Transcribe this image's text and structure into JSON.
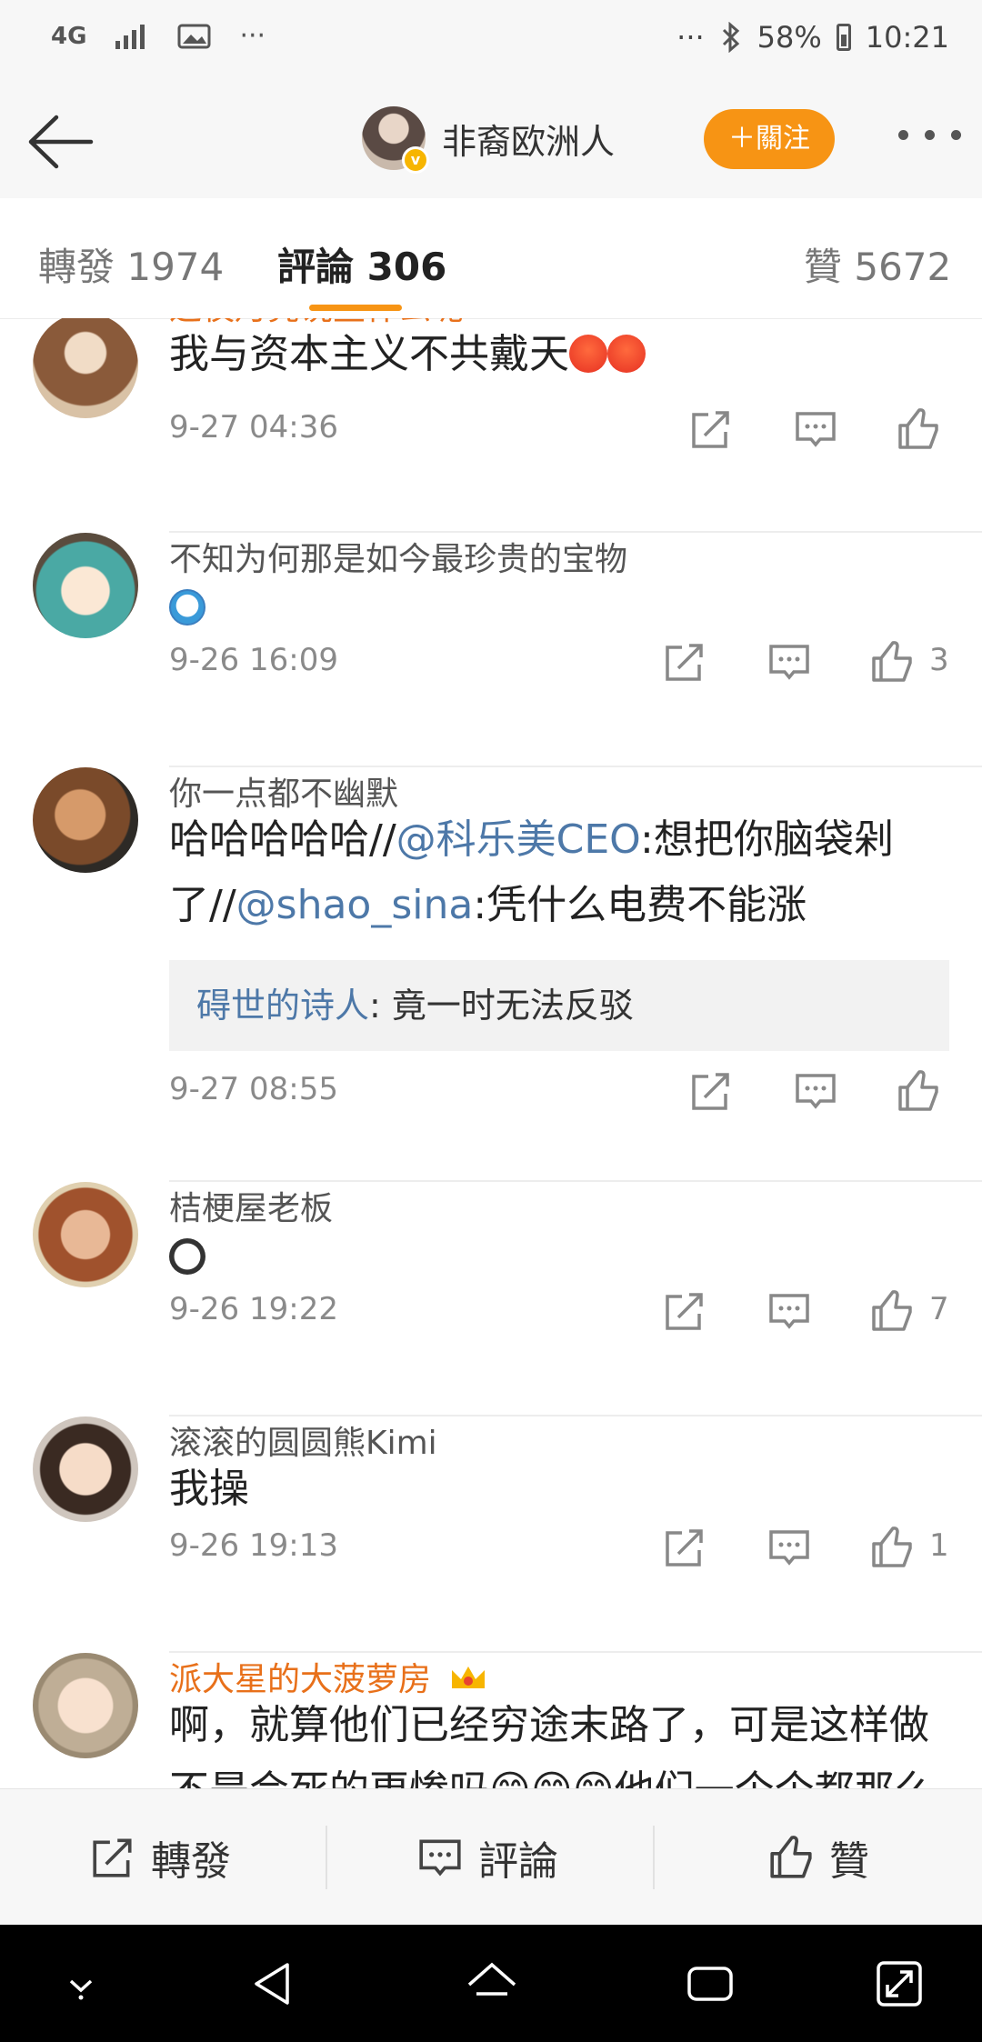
{
  "status_bar": {
    "network": "4G",
    "more": "···",
    "right_more": "···",
    "battery": "58%",
    "time": "10:21"
  },
  "nav": {
    "title": "非裔欧洲人",
    "follow_label": "＋關注"
  },
  "tabs": {
    "repost": "轉發 1974",
    "comments": "評論 306",
    "likes": "贊 5672"
  },
  "comments": [
    {
      "user": "这夜月亮说些什么呢",
      "text": "我与资本主义不共戴天",
      "time": "9-27 04:36",
      "likes": ""
    },
    {
      "user": "不知为何那是如今最珍贵的宝物",
      "time": "9-26 16:09",
      "likes": "3"
    },
    {
      "user": "你一点都不幽默",
      "text_a": "哈哈哈哈哈//",
      "mention_1": "@科乐美CEO",
      "text_b": ":想把你脑袋剁",
      "text_c": "了//",
      "mention_2": "@shao_sina",
      "text_d": ":凭什么电费不能涨",
      "reply_user": "碍世的诗人",
      "reply_text": ": 竟一时无法反驳",
      "time": "9-27 08:55",
      "likes": ""
    },
    {
      "user": "桔梗屋老板",
      "time": "9-26 19:22",
      "likes": "7"
    },
    {
      "user": "滚滚的圆圆熊Kimi",
      "text": "我操",
      "time": "9-26 19:13",
      "likes": "1"
    },
    {
      "user": "派大星的大菠萝房",
      "text": "啊，就算他们已经穷途末路了，可是这样做",
      "text_cut": "不是会死的更惨吗😊😊😊他们一个个都那么"
    }
  ],
  "bottom_bar": {
    "repost": "轉發",
    "comment": "評論",
    "like": "贊"
  },
  "colors": {
    "accent": "#f79414",
    "mention": "#4d78a8",
    "vip_name": "#e8701a"
  }
}
